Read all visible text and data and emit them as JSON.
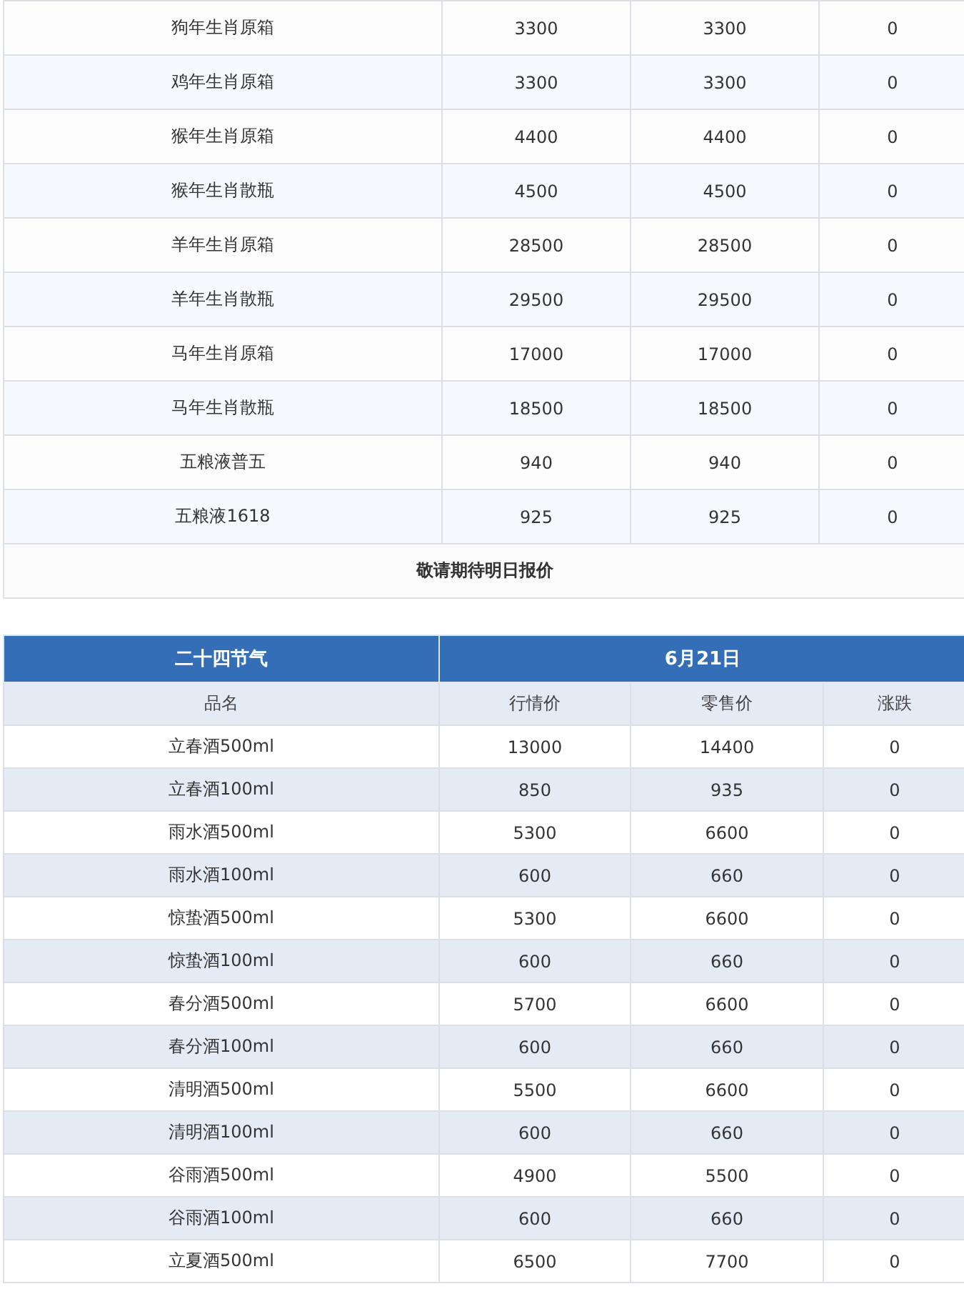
{
  "zodiac_table": {
    "rows": [
      {
        "name": "狗年生肖原箱",
        "column_2": "3300",
        "column_3": "3300",
        "column_4": "0"
      },
      {
        "name": "鸡年生肖原箱",
        "column_2": "3300",
        "column_3": "3300",
        "column_4": "0"
      },
      {
        "name": "猴年生肖原箱",
        "column_2": "4400",
        "column_3": "4400",
        "column_4": "0"
      },
      {
        "name": "猴年生肖散瓶",
        "column_2": "4500",
        "column_3": "4500",
        "column_4": "0"
      },
      {
        "name": "羊年生肖原箱",
        "column_2": "28500",
        "column_3": "28500",
        "column_4": "0"
      },
      {
        "name": "羊年生肖散瓶",
        "column_2": "29500",
        "column_3": "29500",
        "column_4": "0"
      },
      {
        "name": "马年生肖原箱",
        "column_2": "17000",
        "column_3": "17000",
        "column_4": "0"
      },
      {
        "name": "马年生肖散瓶",
        "column_2": "18500",
        "column_3": "18500",
        "column_4": "0"
      },
      {
        "name": "五粮液普五",
        "column_2": "940",
        "column_3": "940",
        "column_4": "0"
      },
      {
        "name": "五粮液1618",
        "column_2": "925",
        "column_3": "925",
        "column_4": "0"
      }
    ],
    "note": "敬请期待明日报价"
  },
  "solar_terms_table": {
    "title": "二十四节气",
    "date": "6月21日",
    "columns": [
      "品名",
      "行情价",
      "零售价",
      "涨跌"
    ],
    "rows": [
      {
        "name": "立春酒500ml",
        "market_price": "13000",
        "retail_price": "14400",
        "change": "0"
      },
      {
        "name": "立春酒100ml",
        "market_price": "850",
        "retail_price": "935",
        "change": "0"
      },
      {
        "name": "雨水酒500ml",
        "market_price": "5300",
        "retail_price": "6600",
        "change": "0"
      },
      {
        "name": "雨水酒100ml",
        "market_price": "600",
        "retail_price": "660",
        "change": "0"
      },
      {
        "name": "惊蛰酒500ml",
        "market_price": "5300",
        "retail_price": "6600",
        "change": "0"
      },
      {
        "name": "惊蛰酒100ml",
        "market_price": "600",
        "retail_price": "660",
        "change": "0"
      },
      {
        "name": "春分酒500ml",
        "market_price": "5700",
        "retail_price": "6600",
        "change": "0"
      },
      {
        "name": "春分酒100ml",
        "market_price": "600",
        "retail_price": "660",
        "change": "0"
      },
      {
        "name": "清明酒500ml",
        "market_price": "5500",
        "retail_price": "6600",
        "change": "0"
      },
      {
        "name": "清明酒100ml",
        "market_price": "600",
        "retail_price": "660",
        "change": "0"
      },
      {
        "name": "谷雨酒500ml",
        "market_price": "4900",
        "retail_price": "5500",
        "change": "0"
      },
      {
        "name": "谷雨酒100ml",
        "market_price": "600",
        "retail_price": "660",
        "change": "0"
      },
      {
        "name": "立夏酒500ml",
        "market_price": "6500",
        "retail_price": "7700",
        "change": "0"
      }
    ]
  }
}
